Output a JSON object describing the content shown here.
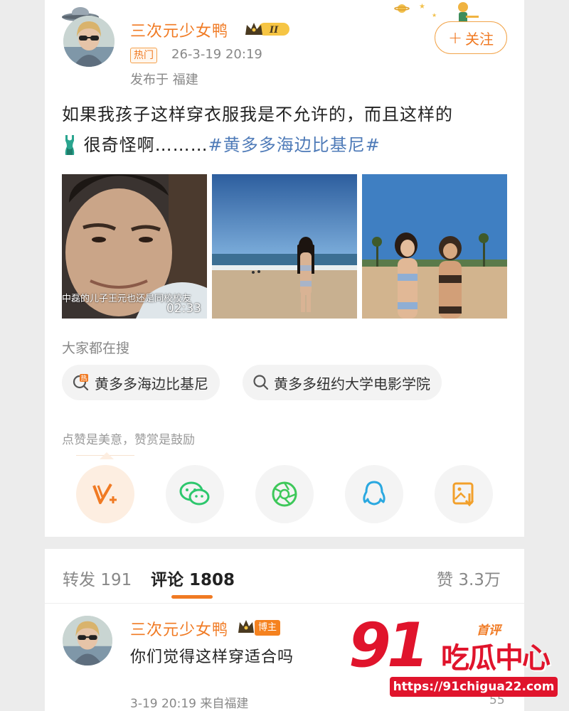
{
  "post": {
    "username": "三次元少女鸭",
    "vip_level": "II",
    "hot_tag": "热门",
    "time": "26-3-19 20:19",
    "location": "发布于 福建",
    "follow_label": "关注",
    "text_before": "如果我孩子这样穿衣服我是不允许的，而且这样的",
    "text_after": "很奇怪啊………",
    "hashtag": "#黄多多海边比基尼#",
    "video_caption": "中磊的儿子王元也还是同校校友",
    "video_duration": "02:33"
  },
  "search": {
    "title": "大家都在搜",
    "items": [
      {
        "label": "黄多多海边比基尼",
        "icon": "hot-search-icon"
      },
      {
        "label": "黄多多纽约大学电影学院",
        "icon": "search-icon"
      }
    ]
  },
  "praise": {
    "title": "点赞是美意，赞赏是鼓励",
    "actions": [
      {
        "name": "reward",
        "icon": "v-plus-icon"
      },
      {
        "name": "wechat",
        "icon": "wechat-icon"
      },
      {
        "name": "moments",
        "icon": "moments-icon"
      },
      {
        "name": "qq",
        "icon": "qq-icon"
      },
      {
        "name": "save-image",
        "icon": "save-image-icon"
      }
    ]
  },
  "tabs": {
    "repost_label": "转发",
    "repost_count": "191",
    "comment_label": "评论",
    "comment_count": "1808",
    "like_label": "赞",
    "like_count": "3.3万"
  },
  "comment": {
    "username": "三次元少女鸭",
    "badge": "博主",
    "first_label": "首评",
    "text": "你们觉得这样穿适合吗",
    "meta": "3-19 20:19  来自福建",
    "like_count": "55"
  },
  "watermark": {
    "number": "91",
    "name": "吃瓜中心",
    "url": "https://91chigua22.com"
  },
  "colors": {
    "accent": "#f07a23",
    "hashtag": "#4f7bb8",
    "watermark": "#e0142c"
  }
}
